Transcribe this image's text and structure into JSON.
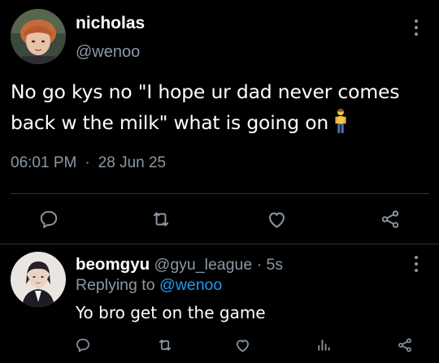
{
  "main_tweet": {
    "display_name": "nicholas",
    "handle": "@wenoo",
    "text": "No go kys no \"I hope ur dad never comes back w the milk\" what is going on",
    "emoji": "standing-person-emoji",
    "time": "06:01 PM",
    "separator": "·",
    "date": "28 Jun 25",
    "actions": [
      "reply-icon",
      "retweet-icon",
      "like-icon",
      "share-icon"
    ]
  },
  "reply_tweet": {
    "display_name": "beomgyu",
    "handle": "@gyu_league",
    "dot": "·",
    "time_ago": "5s",
    "replying_prefix": "Replying to",
    "replying_handle": "@wenoo",
    "text": "Yo bro get on the game",
    "actions": [
      "reply-icon",
      "retweet-icon",
      "like-icon",
      "views-icon",
      "share-icon"
    ]
  },
  "colors": {
    "background": "#000000",
    "text_primary": "#ffffff",
    "text_secondary": "#8b98a5",
    "accent": "#1d9bf0",
    "divider": "#2f3336"
  }
}
